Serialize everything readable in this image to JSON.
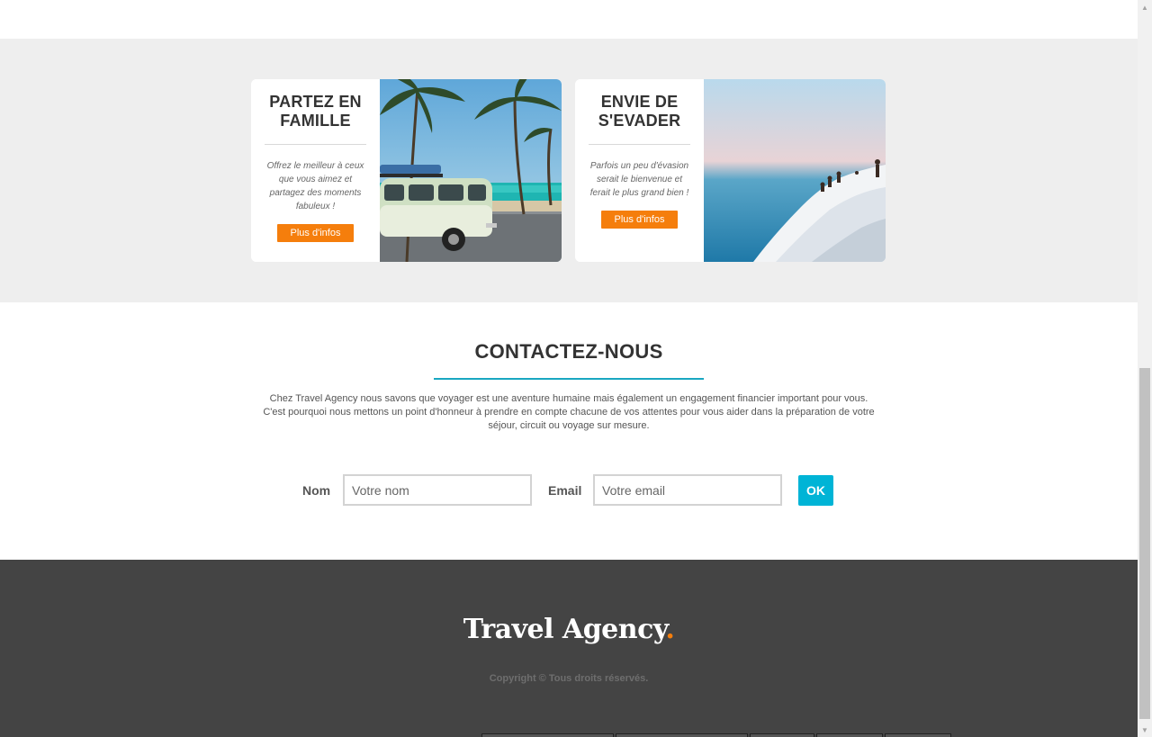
{
  "cards": [
    {
      "title_line1": "PARTEZ EN",
      "title_line2": "FAMILLE",
      "description": "Offrez le meilleur à ceux que vous aimez et partagez des moments fabuleux !",
      "button_label": "Plus d'infos"
    },
    {
      "title_line1": "ENVIE DE",
      "title_line2": "S'EVADER",
      "description": "Parfois un peu d'évasion serait le bienvenue et ferait le plus grand bien !",
      "button_label": "Plus d'infos"
    }
  ],
  "contact": {
    "title": "CONTACTEZ-NOUS",
    "description_line1": "Chez Travel Agency nous savons que voyager est une aventure humaine mais également un engagement financier important pour vous.",
    "description_line2": "C'est pourquoi nous mettons un point d'honneur à prendre en compte chacune de vos attentes pour vous aider dans la préparation de votre",
    "description_line3": "séjour, circuit ou voyage sur mesure.",
    "name_label": "Nom",
    "name_placeholder": "Votre nom",
    "email_label": "Email",
    "email_placeholder": "Votre email",
    "submit_label": "OK"
  },
  "footer": {
    "logo_text": "Travel Agency",
    "logo_dot": ".",
    "copyright": "Copyright © Tous droits réservés."
  },
  "colors": {
    "accent_orange": "#f57e0c",
    "accent_cyan": "#00b4d6",
    "footer_bg": "#444444",
    "band_bg": "#eeeeee"
  },
  "icons": {
    "scroll_up": "triangle-up-icon",
    "scroll_down": "triangle-down-icon"
  }
}
